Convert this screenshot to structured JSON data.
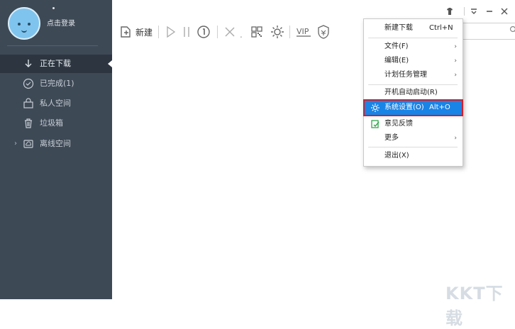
{
  "sidebar": {
    "login_text": "点击登录",
    "items": [
      {
        "label": "正在下载",
        "icon": "download-arrow-icon"
      },
      {
        "label": "已完成(1)",
        "icon": "check-circle-icon"
      },
      {
        "label": "私人空间",
        "icon": "lock-folder-icon"
      },
      {
        "label": "垃圾箱",
        "icon": "trash-icon"
      },
      {
        "label": "离线空间",
        "icon": "cloud-folder-icon"
      }
    ]
  },
  "toolbar": {
    "new_label": "新建",
    "icons": [
      "new-file-icon",
      "play-icon",
      "pause-icon",
      "speed-limit-icon",
      "delete-icon",
      "qr-code-icon",
      "settings-icon",
      "vip-icon",
      "shield-icon"
    ]
  },
  "window_controls": [
    "skin-icon",
    "menu-icon",
    "minimize-icon",
    "close-icon"
  ],
  "context_menu": {
    "items": [
      {
        "label": "新建下载",
        "shortcut": "Ctrl+N"
      },
      {
        "label": "文件(F)",
        "submenu": "›"
      },
      {
        "label": "编辑(E)",
        "submenu": "›"
      },
      {
        "label": "计划任务管理",
        "submenu": "›"
      },
      {
        "label": "开机自动启动(R)"
      },
      {
        "label": "系统设置(O)",
        "shortcut": "Alt+O",
        "highlighted": true,
        "icon": "gear-icon"
      },
      {
        "label": "意见反馈",
        "icon": "feedback-icon"
      },
      {
        "label": "更多",
        "submenu": "›"
      },
      {
        "label": "退出(X)"
      }
    ]
  },
  "colors": {
    "sidebar_bg": "#3e4956",
    "highlight": "#1a83e6",
    "highlight_border": "#d11f2b",
    "feedback_icon": "#2fa74a"
  },
  "watermark": "KKT下载"
}
